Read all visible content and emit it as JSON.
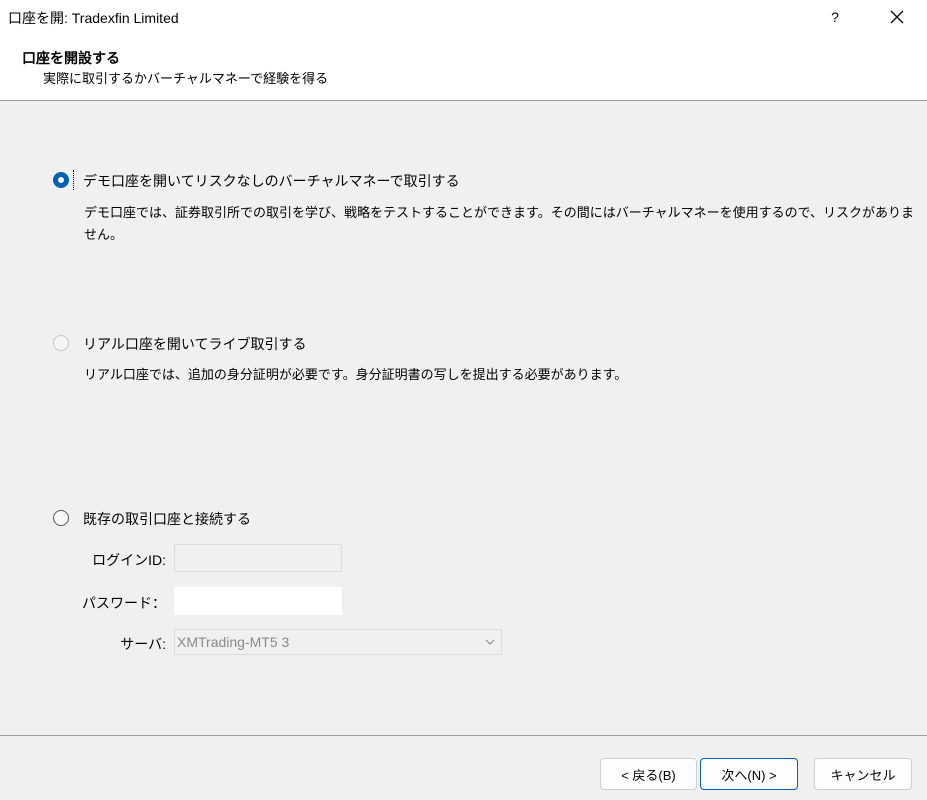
{
  "window": {
    "title": "口座を開: Tradexfin Limited",
    "help_label": "?",
    "close_icon": "close-icon"
  },
  "header": {
    "title": "口座を開設する",
    "subtitle": "実際に取引するかバーチャルマネーで経験を得る"
  },
  "options": [
    {
      "label": "デモ口座を開いてリスクなしのバーチャルマネーで取引する",
      "description_line1": "デモ口座では、証券取引所での取引を学び、戦略をテストすることができます。その間にはバーチャルマネーを使用するので、リスクがありま",
      "description_line2": "せん。",
      "state": "selected"
    },
    {
      "label": "リアル口座を開いてライブ取引する",
      "description": "リアル口座では、追加の身分証明が必要です。身分証明書の写しを提出する必要があります。",
      "state": "disabled"
    },
    {
      "label": "既存の取引口座と接続する",
      "state": "unselected"
    }
  ],
  "login_form": {
    "login_label": "ログインID:",
    "login_value": "",
    "password_label": "パスワード：",
    "password_value": "",
    "server_label": "サーバ:",
    "server_value": "XMTrading-MT5 3"
  },
  "buttons": {
    "back": "< 戻る(B)",
    "next": "次へ(N) >",
    "cancel": "キャンセル"
  },
  "colors": {
    "accent": "#005fb8",
    "background": "#f0f0f0"
  }
}
